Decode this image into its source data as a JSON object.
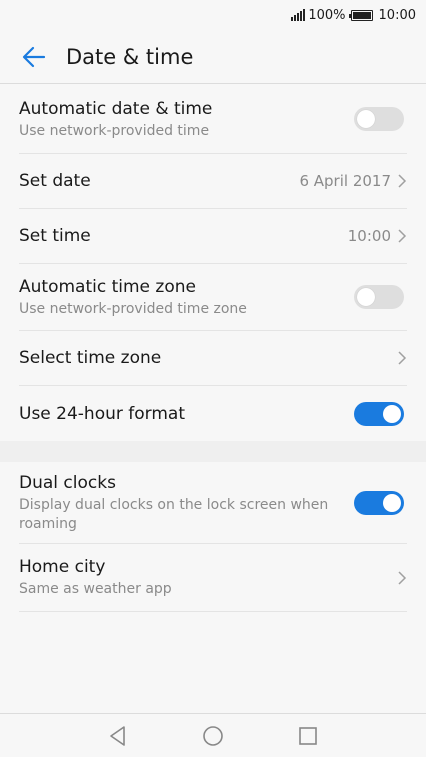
{
  "status_bar": {
    "battery_percent": "100%",
    "time": "10:00"
  },
  "header": {
    "title": "Date & time",
    "back_icon": "arrow-left-icon"
  },
  "colors": {
    "accent": "#1a7bdf",
    "toggle_off": "#dedede",
    "secondary_text": "#8a8a8a"
  },
  "settings": [
    {
      "title": "Automatic date & time",
      "subtitle": "Use network-provided time",
      "control": "toggle",
      "enabled": false
    },
    {
      "title": "Set date",
      "value": "6 April 2017",
      "control": "chevron"
    },
    {
      "title": "Set time",
      "value": "10:00",
      "control": "chevron"
    },
    {
      "title": "Automatic time zone",
      "subtitle": "Use network-provided time zone",
      "control": "toggle",
      "enabled": false
    },
    {
      "title": "Select time zone",
      "control": "chevron"
    },
    {
      "title": "Use 24-hour format",
      "control": "toggle",
      "enabled": true
    }
  ],
  "settings2": [
    {
      "title": "Dual clocks",
      "subtitle": "Display dual clocks on the lock screen when roaming",
      "control": "toggle",
      "enabled": true
    },
    {
      "title": "Home city",
      "subtitle": "Same as weather app",
      "control": "chevron"
    }
  ],
  "nav_bar": {
    "back": "triangle-back-icon",
    "home": "circle-home-icon",
    "recents": "square-recents-icon"
  }
}
